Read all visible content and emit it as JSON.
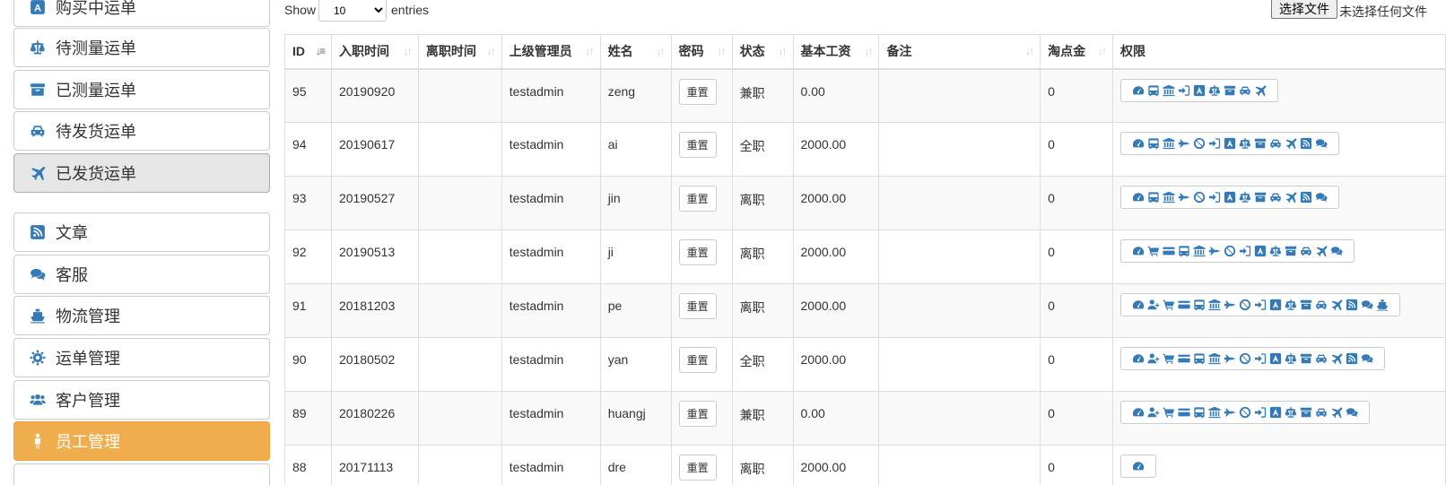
{
  "sidebar": {
    "items": [
      {
        "label": "购买中运单",
        "icon": "amazon-icon"
      },
      {
        "label": "待测量运单",
        "icon": "balance-scale-icon"
      },
      {
        "label": "已测量运单",
        "icon": "archive-icon"
      },
      {
        "label": "待发货运单",
        "icon": "car-icon"
      },
      {
        "label": "已发货运单",
        "icon": "plane-icon"
      },
      {
        "label": "文章",
        "icon": "rss-icon"
      },
      {
        "label": "客服",
        "icon": "comments-icon"
      },
      {
        "label": "物流管理",
        "icon": "ship-icon"
      },
      {
        "label": "运单管理",
        "icon": "gear-icon"
      },
      {
        "label": "客户管理",
        "icon": "users-icon"
      },
      {
        "label": "员工管理",
        "icon": "male-icon"
      }
    ],
    "accent": "#f0ad4e"
  },
  "toolbar": {
    "show_label": "Show",
    "page_size": "10",
    "entries_label": "entries",
    "file_button": "选择文件",
    "file_status": "未选择任何文件"
  },
  "table": {
    "headers": [
      "ID",
      "入职时间",
      "离职时间",
      "上级管理员",
      "姓名",
      "密码",
      "状态",
      "基本工资",
      "备注",
      "淘点金",
      "权限"
    ],
    "reset_label": "重置",
    "rows": [
      {
        "id": "95",
        "hired": "20190920",
        "left": "",
        "manager": "testadmin",
        "name": "zeng",
        "status": "兼职",
        "salary": "0.00",
        "note": "",
        "points": "0",
        "perms": [
          "dashboard",
          "bus",
          "bank",
          "sign-in",
          "amazon",
          "balance-scale",
          "archive",
          "car",
          "plane"
        ]
      },
      {
        "id": "94",
        "hired": "20190617",
        "left": "",
        "manager": "testadmin",
        "name": "ai",
        "status": "全职",
        "salary": "2000.00",
        "note": "",
        "points": "0",
        "perms": [
          "dashboard",
          "bus",
          "bank",
          "fighter-jet",
          "ban",
          "sign-in",
          "amazon",
          "balance-scale",
          "archive",
          "car",
          "plane",
          "rss",
          "comments"
        ]
      },
      {
        "id": "93",
        "hired": "20190527",
        "left": "",
        "manager": "testadmin",
        "name": "jin",
        "status": "离职",
        "salary": "2000.00",
        "note": "",
        "points": "0",
        "perms": [
          "dashboard",
          "bus",
          "bank",
          "fighter-jet",
          "ban",
          "sign-in",
          "amazon",
          "balance-scale",
          "archive",
          "car",
          "plane",
          "rss",
          "comments"
        ]
      },
      {
        "id": "92",
        "hired": "20190513",
        "left": "",
        "manager": "testadmin",
        "name": "ji",
        "status": "离职",
        "salary": "2000.00",
        "note": "",
        "points": "0",
        "perms": [
          "dashboard",
          "cart",
          "credit-card",
          "bus",
          "bank",
          "fighter-jet",
          "ban",
          "sign-in",
          "amazon",
          "balance-scale",
          "archive",
          "car",
          "plane",
          "comments"
        ]
      },
      {
        "id": "91",
        "hired": "20181203",
        "left": "",
        "manager": "testadmin",
        "name": "pe",
        "status": "离职",
        "salary": "2000.00",
        "note": "",
        "points": "0",
        "perms": [
          "dashboard",
          "user-plus",
          "cart",
          "credit-card",
          "bus",
          "bank",
          "fighter-jet",
          "ban",
          "sign-in",
          "amazon",
          "balance-scale",
          "archive",
          "car",
          "plane",
          "rss",
          "comments",
          "ship"
        ]
      },
      {
        "id": "90",
        "hired": "20180502",
        "left": "",
        "manager": "testadmin",
        "name": "yan",
        "status": "全职",
        "salary": "2000.00",
        "note": "",
        "points": "0",
        "perms": [
          "dashboard",
          "user-plus",
          "cart",
          "credit-card",
          "bus",
          "bank",
          "fighter-jet",
          "ban",
          "sign-in",
          "amazon",
          "balance-scale",
          "archive",
          "car",
          "plane",
          "rss",
          "comments"
        ]
      },
      {
        "id": "89",
        "hired": "20180226",
        "left": "",
        "manager": "testadmin",
        "name": "huangj",
        "status": "兼职",
        "salary": "0.00",
        "note": "",
        "points": "0",
        "perms": [
          "dashboard",
          "user-plus",
          "cart",
          "credit-card",
          "bus",
          "bank",
          "fighter-jet",
          "ban",
          "sign-in",
          "amazon",
          "balance-scale",
          "archive",
          "car",
          "plane",
          "comments"
        ]
      },
      {
        "id": "88",
        "hired": "20171113",
        "left": "",
        "manager": "testadmin",
        "name": "dre",
        "status": "离职",
        "salary": "2000.00",
        "note": "",
        "points": "0",
        "perms": [
          "dashboard"
        ]
      }
    ]
  }
}
